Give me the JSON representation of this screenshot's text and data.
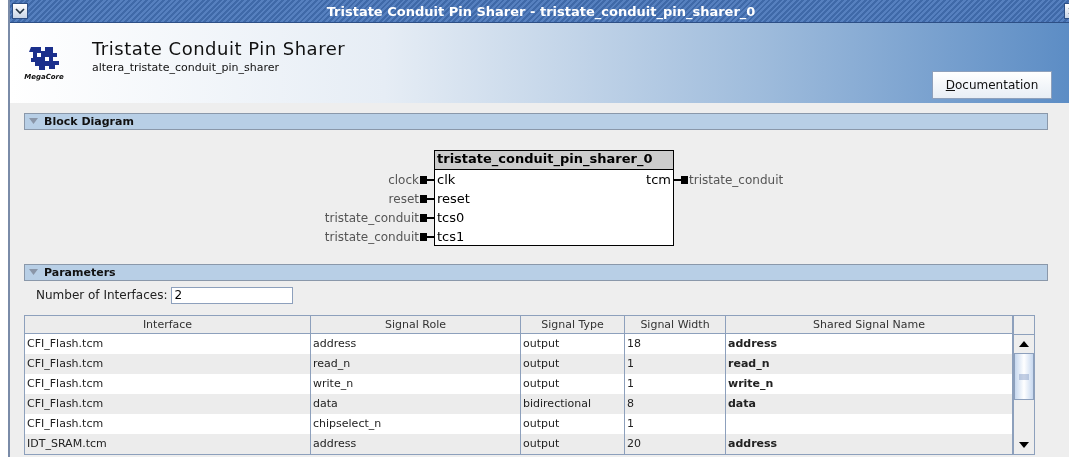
{
  "window": {
    "title": "Tristate Conduit Pin Sharer - tristate_conduit_pin_sharer_0"
  },
  "header": {
    "logo_text": "MegaCore",
    "title": "Tristate Conduit Pin Sharer",
    "subtitle": "altera_tristate_conduit_pin_sharer",
    "button": "Documentation"
  },
  "block_diagram": {
    "heading": "Block Diagram",
    "expanded": true,
    "instance": "tristate_conduit_pin_sharer_0",
    "inputs": [
      {
        "signal": "clock",
        "port": "clk"
      },
      {
        "signal": "reset",
        "port": "reset"
      },
      {
        "signal": "tristate_conduit",
        "port": "tcs0"
      },
      {
        "signal": "tristate_conduit",
        "port": "tcs1"
      }
    ],
    "outputs": [
      {
        "port": "tcm",
        "signal": "tristate_conduit"
      }
    ]
  },
  "parameters": {
    "heading": "Parameters",
    "expanded": true,
    "field_label": "Number of Interfaces:",
    "field_value": "2",
    "table": {
      "columns": [
        "Interface",
        "Signal Role",
        "Signal Type",
        "Signal Width",
        "Shared Signal Name"
      ],
      "rows": [
        [
          "CFI_Flash.tcm",
          "address",
          "output",
          "18",
          "address"
        ],
        [
          "CFI_Flash.tcm",
          "read_n",
          "output",
          "1",
          "read_n"
        ],
        [
          "CFI_Flash.tcm",
          "write_n",
          "output",
          "1",
          "write_n"
        ],
        [
          "CFI_Flash.tcm",
          "data",
          "bidirectional",
          "8",
          "data"
        ],
        [
          "CFI_Flash.tcm",
          "chipselect_n",
          "output",
          "1",
          ""
        ],
        [
          "IDT_SRAM.tcm",
          "address",
          "output",
          "20",
          "address"
        ]
      ]
    }
  }
}
